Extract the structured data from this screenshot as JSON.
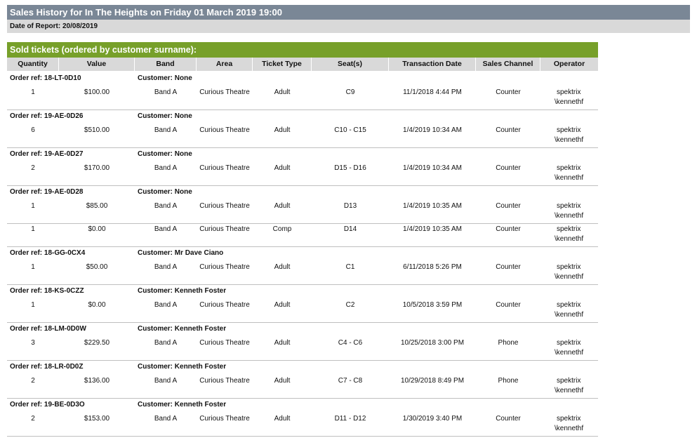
{
  "report": {
    "title": "Sales History for In The Heights on Friday 01 March 2019 19:00",
    "date_of_report": "Date of Report: 20/08/2019",
    "section_title": "Sold tickets (ordered by customer surname):"
  },
  "columns": [
    "Quantity",
    "Value",
    "Band",
    "Area",
    "Ticket Type",
    "Seat(s)",
    "Transaction Date",
    "Sales Channel",
    "Operator"
  ],
  "groups": [
    {
      "order_ref": "Order ref: 18-LT-0D10",
      "customer": "Customer: None",
      "rows": [
        {
          "quantity": "1",
          "value": "$100.00",
          "band": "Band A",
          "area": "Curious Theatre",
          "ticket_type": "Adult",
          "seats": "C9",
          "date": "11/1/2018 4:44 PM",
          "channel": "Counter",
          "operator1": "spektrix",
          "operator2": "\\kennethf"
        }
      ]
    },
    {
      "order_ref": "Order ref: 19-AE-0D26",
      "customer": "Customer: None",
      "rows": [
        {
          "quantity": "6",
          "value": "$510.00",
          "band": "Band A",
          "area": "Curious Theatre",
          "ticket_type": "Adult",
          "seats": "C10 - C15",
          "date": "1/4/2019 10:34 AM",
          "channel": "Counter",
          "operator1": "spektrix",
          "operator2": "\\kennethf"
        }
      ]
    },
    {
      "order_ref": "Order ref: 19-AE-0D27",
      "customer": "Customer: None",
      "rows": [
        {
          "quantity": "2",
          "value": "$170.00",
          "band": "Band A",
          "area": "Curious Theatre",
          "ticket_type": "Adult",
          "seats": "D15 - D16",
          "date": "1/4/2019 10:34 AM",
          "channel": "Counter",
          "operator1": "spektrix",
          "operator2": "\\kennethf"
        }
      ]
    },
    {
      "order_ref": "Order ref: 19-AE-0D28",
      "customer": "Customer: None",
      "rows": [
        {
          "quantity": "1",
          "value": "$85.00",
          "band": "Band A",
          "area": "Curious Theatre",
          "ticket_type": "Adult",
          "seats": "D13",
          "date": "1/4/2019 10:35 AM",
          "channel": "Counter",
          "operator1": "spektrix",
          "operator2": "\\kennethf"
        },
        {
          "quantity": "1",
          "value": "$0.00",
          "band": "Band A",
          "area": "Curious Theatre",
          "ticket_type": "Comp",
          "seats": "D14",
          "date": "1/4/2019 10:35 AM",
          "channel": "Counter",
          "operator1": "spektrix",
          "operator2": "\\kennethf"
        }
      ]
    },
    {
      "order_ref": "Order ref: 18-GG-0CX4",
      "customer": "Customer: Mr Dave Ciano",
      "rows": [
        {
          "quantity": "1",
          "value": "$50.00",
          "band": "Band A",
          "area": "Curious Theatre",
          "ticket_type": "Adult",
          "seats": "C1",
          "date": "6/11/2018 5:26 PM",
          "channel": "Counter",
          "operator1": "spektrix",
          "operator2": "\\kennethf"
        }
      ]
    },
    {
      "order_ref": "Order ref: 18-KS-0CZZ",
      "customer": "Customer: Kenneth Foster",
      "rows": [
        {
          "quantity": "1",
          "value": "$0.00",
          "band": "Band A",
          "area": "Curious Theatre",
          "ticket_type": "Adult",
          "seats": "C2",
          "date": "10/5/2018 3:59 PM",
          "channel": "Counter",
          "operator1": "spektrix",
          "operator2": "\\kennethf"
        }
      ]
    },
    {
      "order_ref": "Order ref: 18-LM-0D0W",
      "customer": "Customer: Kenneth Foster",
      "rows": [
        {
          "quantity": "3",
          "value": "$229.50",
          "band": "Band A",
          "area": "Curious Theatre",
          "ticket_type": "Adult",
          "seats": "C4 - C6",
          "date": "10/25/2018 3:00 PM",
          "channel": "Phone",
          "operator1": "spektrix",
          "operator2": "\\kennethf"
        }
      ]
    },
    {
      "order_ref": "Order ref: 18-LR-0D0Z",
      "customer": "Customer: Kenneth Foster",
      "rows": [
        {
          "quantity": "2",
          "value": "$136.00",
          "band": "Band A",
          "area": "Curious Theatre",
          "ticket_type": "Adult",
          "seats": "C7 - C8",
          "date": "10/29/2018 8:49 PM",
          "channel": "Phone",
          "operator1": "spektrix",
          "operator2": "\\kennethf"
        }
      ]
    },
    {
      "order_ref": "Order ref: 19-BE-0D3O",
      "customer": "Customer: Kenneth Foster",
      "rows": [
        {
          "quantity": "2",
          "value": "$153.00",
          "band": "Band A",
          "area": "Curious Theatre",
          "ticket_type": "Adult",
          "seats": "D11 - D12",
          "date": "1/30/2019 3:40 PM",
          "channel": "Counter",
          "operator1": "spektrix",
          "operator2": "\\kennethf"
        }
      ]
    }
  ]
}
